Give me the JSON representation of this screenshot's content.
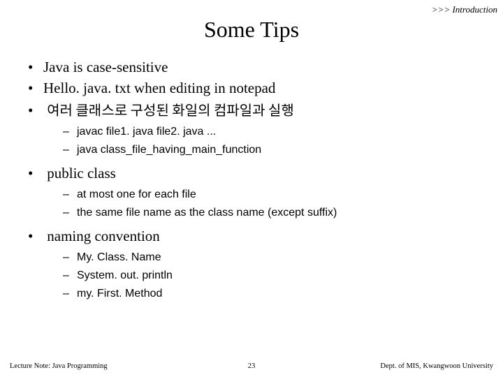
{
  "breadcrumb": ">>> Introduction",
  "title": "Some Tips",
  "bullets": {
    "b0": "Java is case-sensitive",
    "b1": "Hello. java. txt when editing in notepad",
    "b2": "여러 클래스로 구성된 화일의 컴파일과 실행",
    "b2_sub": {
      "s0": "javac file1. java  file2. java ...",
      "s1": "java  class_file_having_main_function"
    },
    "b3": "public class",
    "b3_sub": {
      "s0": "at most one for each file",
      "s1": "the same file name as the class name (except suffix)"
    },
    "b4": "naming convention",
    "b4_sub": {
      "s0": "My. Class. Name",
      "s1": "System. out. println",
      "s2": "my. First. Method"
    }
  },
  "footer": {
    "left": "Lecture Note: Java Programming",
    "center": "23",
    "right": "Dept. of MIS, Kwangwoon University"
  }
}
